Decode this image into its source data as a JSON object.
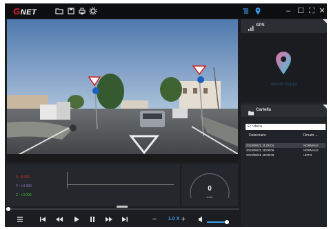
{
  "app": {
    "brand": "NET",
    "brand_initial": "G"
  },
  "titlebar": {
    "icons": [
      "folder-icon",
      "save-icon",
      "print-icon",
      "settings-icon",
      "list-icon",
      "location-pin-icon"
    ],
    "window_buttons": {
      "minimize": "–",
      "maximize": "☐",
      "expand": "⛶",
      "close": "✕"
    }
  },
  "sensor": {
    "x_label": "X : 0.000",
    "y_label": "Y : +0.000",
    "z_label": "Z : +0.000",
    "colors": {
      "x": "#e0302a",
      "y": "#9a7bd6",
      "z": "#49c23a"
    }
  },
  "speedometer": {
    "value": "0",
    "unit": "km/h"
  },
  "controls": {
    "zoom_minus": "−",
    "zoom_value": "1.0 X",
    "zoom_plus": "+",
    "playback_progress": 0,
    "volume_level": 0.85
  },
  "gps": {
    "title": "GPS",
    "map_text": "Vedere mappa"
  },
  "files": {
    "title": "Cartella",
    "path": "E:\\data",
    "col_datetime": "Data/orario",
    "col_filter": "Filmato  ⌄",
    "rows": [
      {
        "timestamp": "2019/08/21 11:08:04",
        "type": "NORMALE",
        "selected": true
      },
      {
        "timestamp": "2019/08/21 18:08:06",
        "type": "NORMALE",
        "selected": false
      },
      {
        "timestamp": "2019/08/21 18:08:09",
        "type": "URTO",
        "selected": false
      }
    ]
  },
  "accent_color": "#3aa0f0"
}
